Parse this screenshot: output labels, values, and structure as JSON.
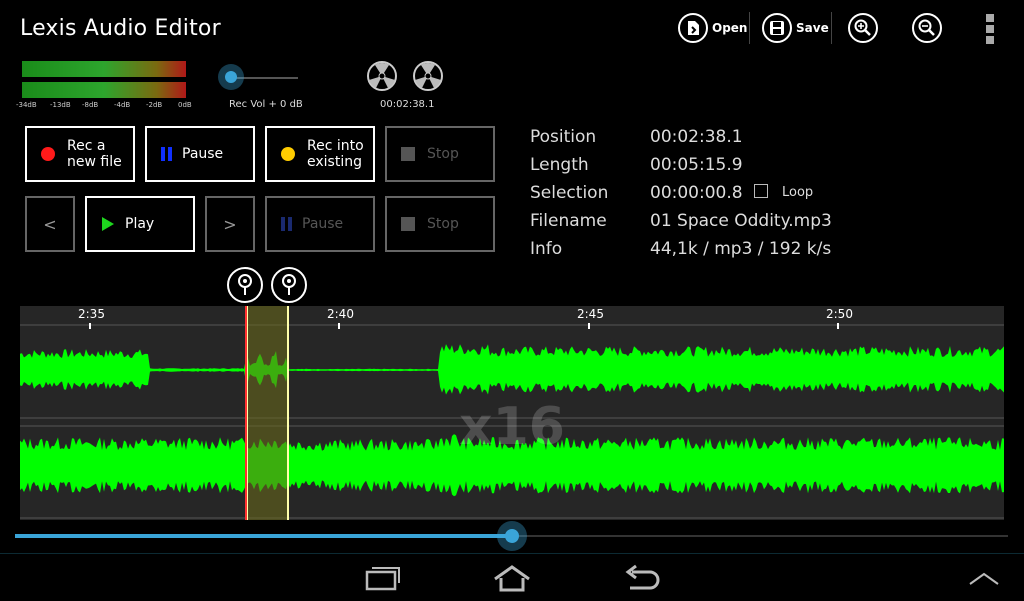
{
  "app": {
    "title": "Lexis Audio Editor"
  },
  "actionbar": {
    "open_label": "Open",
    "save_label": "Save",
    "icons": [
      "open-file-icon",
      "save-icon",
      "zoom-in-icon",
      "zoom-out-icon",
      "overflow-menu-icon"
    ]
  },
  "meter": {
    "scale": [
      "-34dB",
      "-13dB",
      "-8dB",
      "-4dB",
      "-2dB",
      "0dB"
    ],
    "level_left": 1.0,
    "level_right": 1.0
  },
  "rec_volume": {
    "label": "Rec Vol + 0 dB",
    "value": 0.0
  },
  "reels": {
    "time": "00:02:38.1"
  },
  "record_row": {
    "rec_new": "Rec a\nnew file",
    "pause": "Pause",
    "rec_into": "Rec into\nexisting",
    "stop": "Stop"
  },
  "play_row": {
    "prev": "<",
    "play": "Play",
    "next": ">",
    "pause": "Pause",
    "stop": "Stop"
  },
  "info": {
    "position_label": "Position",
    "position": "00:02:38.1",
    "length_label": "Length",
    "length": "00:05:15.9",
    "selection_label": "Selection",
    "selection": "00:00:00.8",
    "loop_label": "Loop",
    "loop_checked": false,
    "filename_label": "Filename",
    "filename": "01 Space Oddity.mp3",
    "info_label": "Info",
    "info": "44,1k / mp3 / 192 k/s"
  },
  "timeline": {
    "ticks": [
      "2:35",
      "2:40",
      "2:45",
      "2:50"
    ],
    "zoom": "x16"
  },
  "colors": {
    "waveform": "#00ff00",
    "accent": "#3aa4d8",
    "selection": "#5a5a1a"
  },
  "seek": {
    "position_fraction": 0.5
  },
  "navbar": {
    "icons": [
      "recent-apps-icon",
      "home-icon",
      "back-icon",
      "chevron-up-icon"
    ]
  }
}
